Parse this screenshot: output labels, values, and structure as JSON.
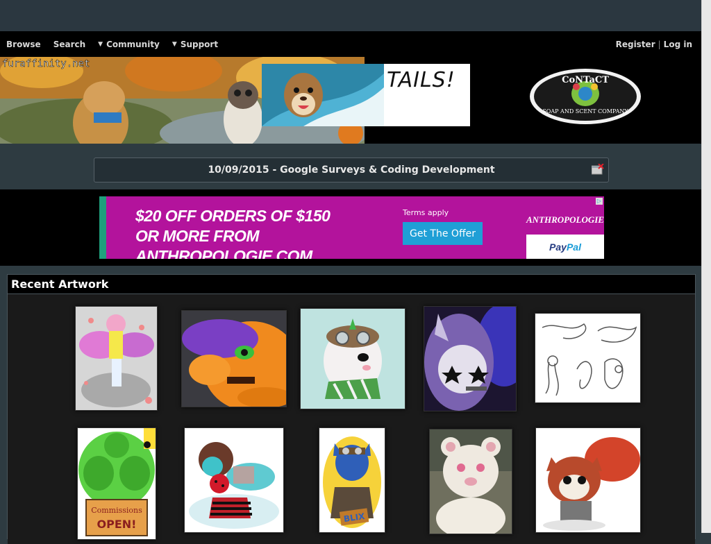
{
  "nav": {
    "browse": "Browse",
    "search": "Search",
    "community": "Community",
    "support": "Support",
    "register": "Register",
    "separator": "|",
    "login": "Log in"
  },
  "banner": {
    "site_watermark": "furaffinity.net",
    "tails_ad_text": "TAILS!",
    "contact_logo_top": "CoNTaCT",
    "contact_logo_bottom": "SOAP AND SCENT COMPANY"
  },
  "notice": {
    "text": "10/09/2015 - Google Surveys & Coding Development"
  },
  "ad": {
    "headline_line1": "$20 OFF ORDERS OF $150",
    "headline_line2": "OR MORE FROM ANTHROPOLOGIE.COM",
    "terms": "Terms apply",
    "cta": "Get The Offer",
    "brand": "ANTHROPOLOGIE",
    "paypal_pay": "Pay",
    "paypal_pal": "Pal"
  },
  "recent": {
    "title": "Recent Artwork",
    "items": [
      {
        "label": "Winged pink character with rose petals"
      },
      {
        "label": "Orange dragon with purple hair portrait"
      },
      {
        "label": "White furry with goggles and green scarf"
      },
      {
        "label": "Dark purple wolf with star eyes"
      },
      {
        "label": "Dragon sketch sheet"
      },
      {
        "label": "Green muscle character - Commissions OPEN!",
        "sign_line1": "Commissions",
        "sign_line2": "OPEN!"
      },
      {
        "label": "Teal cat with red polka dot scarf"
      },
      {
        "label": "Blue cat with goggles badge",
        "badge_text": "BLIX"
      },
      {
        "label": "White rat fursuit photo"
      },
      {
        "label": "Red panda chibi"
      }
    ]
  },
  "colors": {
    "page_bg": "#2e3b41",
    "nav_bg": "#000000",
    "ad_bg": "#b3139c",
    "cta_bg": "#1f9fd6"
  }
}
